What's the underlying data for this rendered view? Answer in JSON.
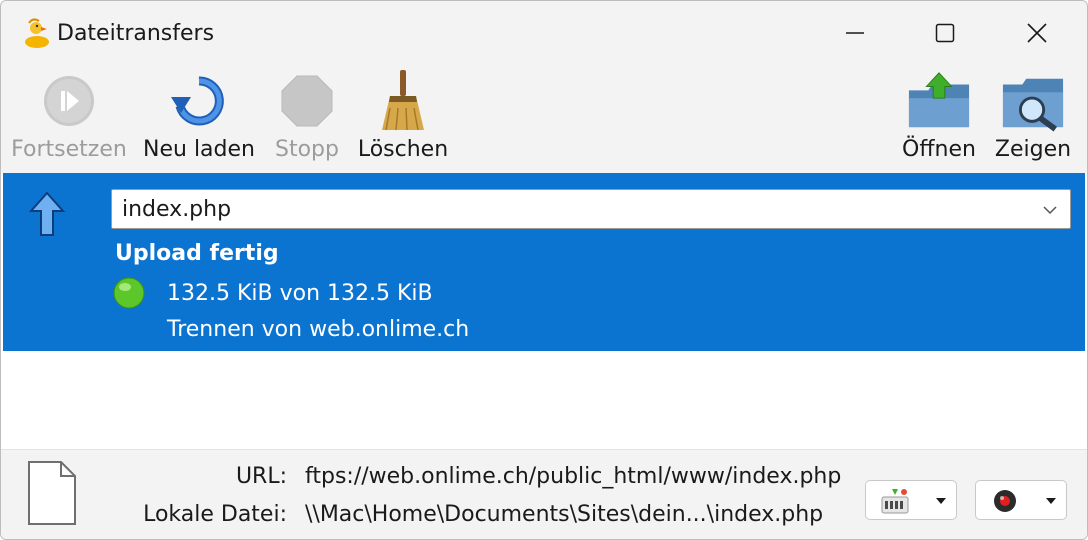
{
  "window": {
    "title": "Dateitransfers"
  },
  "toolbar": {
    "resume_label": "Fortsetzen",
    "reload_label": "Neu laden",
    "stop_label": "Stopp",
    "clean_label": "Löschen",
    "open_label": "Öffnen",
    "show_label": "Zeigen"
  },
  "transfer": {
    "file": "index.php",
    "status": "Upload fertig",
    "progress_text": "132.5 KiB von 132.5 KiB",
    "connection_text": "Trennen von web.onlime.ch",
    "progress_fraction": 1.0
  },
  "info": {
    "url_label": "URL:",
    "url_value": "ftps://web.onlime.ch/public_html/www/index.php",
    "local_label": "Lokale Datei:",
    "local_value": "\\\\Mac\\Home\\Documents\\Sites\\dein...\\index.php"
  },
  "colors": {
    "selection": "#0b74d1",
    "status_ok": "#5cc72a"
  }
}
